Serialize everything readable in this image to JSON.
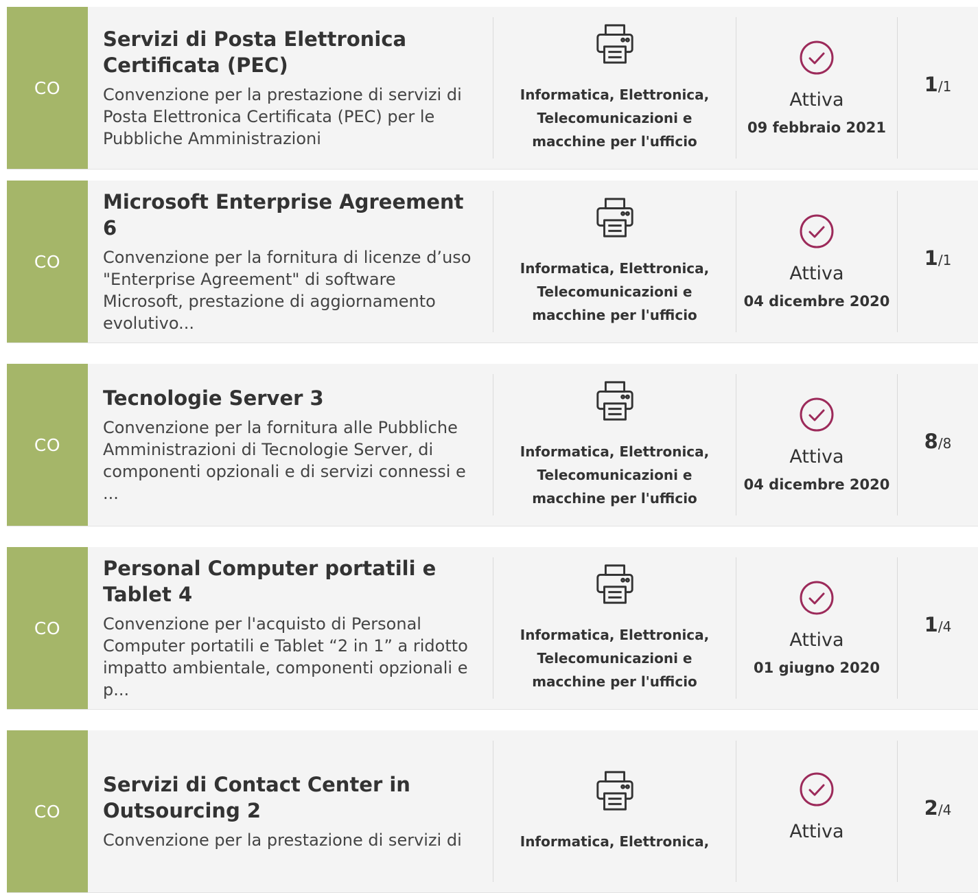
{
  "rows": [
    {
      "badge": "CO",
      "title": "Servizi di Posta Elettronica Certificata (PEC)",
      "description": "Convenzione per la prestazione di servizi di Posta Elettronica Certificata (PEC) per le Pubbliche Amministrazioni",
      "category": "Informatica, Elettronica, Telecomunicazioni e macchine per l'ufficio",
      "category_icon": "printer-icon",
      "status": "Attiva",
      "status_icon": "check-circle-icon",
      "date": "09 febbraio 2021",
      "count_main": "1",
      "count_total": "/1"
    },
    {
      "badge": "CO",
      "title": "Microsoft Enterprise Agreement 6",
      "description": "Convenzione per la fornitura di licenze d’uso \"Enterprise Agreement\" di software Microsoft, prestazione di aggiornamento evolutivo...",
      "category": "Informatica, Elettronica, Telecomunicazioni e macchine per l'ufficio",
      "category_icon": "printer-icon",
      "status": "Attiva",
      "status_icon": "check-circle-icon",
      "date": "04 dicembre 2020",
      "count_main": "1",
      "count_total": "/1"
    },
    {
      "badge": "CO",
      "title": "Tecnologie Server 3",
      "description": "Convenzione per la fornitura alle Pubbliche Amministrazioni di Tecnologie Server, di componenti opzionali e di servizi connessi e ...",
      "category": "Informatica, Elettronica, Telecomunicazioni e macchine per l'ufficio",
      "category_icon": "printer-icon",
      "status": "Attiva",
      "status_icon": "check-circle-icon",
      "date": "04 dicembre 2020",
      "count_main": "8",
      "count_total": "/8"
    },
    {
      "badge": "CO",
      "title": "Personal Computer portatili e Tablet 4",
      "description": "Convenzione per l'acquisto di Personal Computer portatili e Tablet “2 in 1” a ridotto impatto ambientale, componenti opzionali e p...",
      "category": "Informatica, Elettronica, Telecomunicazioni e macchine per l'ufficio",
      "category_icon": "printer-icon",
      "status": "Attiva",
      "status_icon": "check-circle-icon",
      "date": "01 giugno 2020",
      "count_main": "1",
      "count_total": "/4"
    },
    {
      "badge": "CO",
      "title": "Servizi di Contact Center in Outsourcing 2",
      "description": "Convenzione per la prestazione di servizi di",
      "category": "Informatica, Elettronica,",
      "category_icon": "printer-icon",
      "status": "Attiva",
      "status_icon": "check-circle-icon",
      "date": "",
      "count_main": "2",
      "count_total": "/4"
    }
  ],
  "colors": {
    "badge": "#a5b669",
    "status_icon": "#9c2a5a",
    "row_background": "#f4f4f4"
  }
}
